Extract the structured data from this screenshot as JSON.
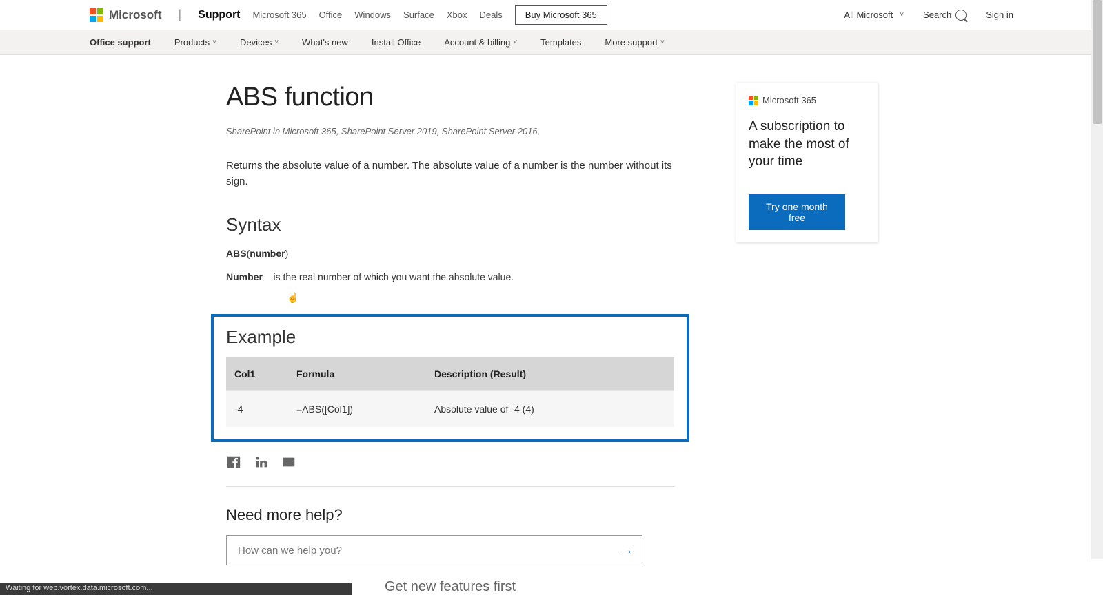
{
  "topbar": {
    "logo_text": "Microsoft",
    "support_label": "Support",
    "nav": [
      "Microsoft 365",
      "Office",
      "Windows",
      "Surface",
      "Xbox",
      "Deals"
    ],
    "buy_label": "Buy Microsoft 365",
    "all_ms": "All Microsoft",
    "search": "Search",
    "signin": "Sign in"
  },
  "secondnav": {
    "office_support": "Office support",
    "items": [
      {
        "label": "Products",
        "drop": true
      },
      {
        "label": "Devices",
        "drop": true
      },
      {
        "label": "What's new",
        "drop": false
      },
      {
        "label": "Install Office",
        "drop": false
      },
      {
        "label": "Account & billing",
        "drop": true
      },
      {
        "label": "Templates",
        "drop": false
      },
      {
        "label": "More support",
        "drop": true
      }
    ]
  },
  "article": {
    "title": "ABS function",
    "applies_to": "SharePoint in Microsoft 365, SharePoint Server 2019, SharePoint Server 2016,",
    "intro": "Returns the absolute value of a number. The absolute value of a number is the number without its sign.",
    "syntax_heading": "Syntax",
    "syntax_fn": "ABS",
    "syntax_arg": "number",
    "arg_name": "Number",
    "arg_desc": "is the real number of which you want the absolute value.",
    "example_heading": "Example",
    "table": {
      "headers": [
        "Col1",
        "Formula",
        "Description (Result)"
      ],
      "row": [
        "-4",
        "=ABS([Col1])",
        "Absolute value of -4 (4)"
      ]
    },
    "need_more_help": "Need more help?",
    "help_placeholder": "How can we help you?",
    "get_new_features": "Get new features first"
  },
  "aside": {
    "brand": "Microsoft 365",
    "tagline": "A subscription to make the most of your time",
    "cta": "Try one month free"
  },
  "statusbar": "Waiting for web.vortex.data.microsoft.com..."
}
